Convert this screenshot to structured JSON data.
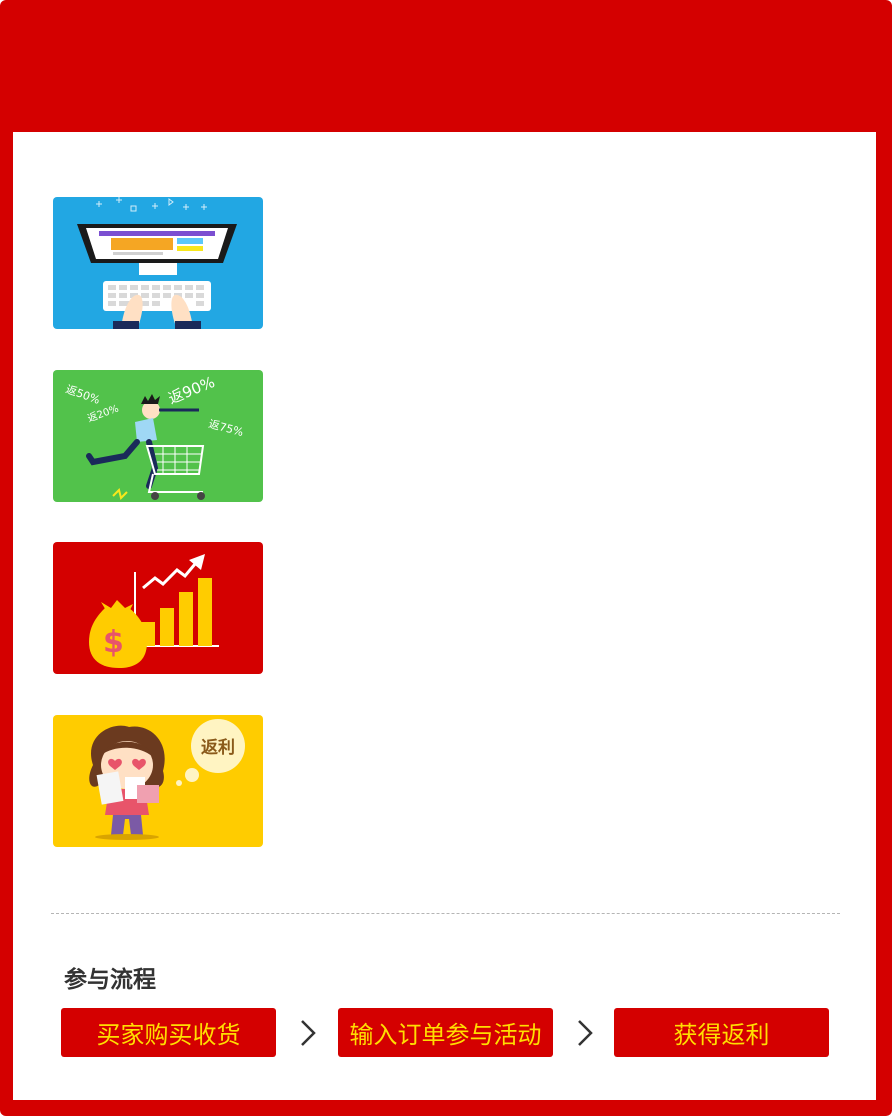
{
  "header": {
    "title": ""
  },
  "cards": [
    {
      "name": "online-shopping",
      "labels": []
    },
    {
      "name": "cashback-shopper",
      "labels": [
        "返50%",
        "返20%",
        "返90%",
        "返75%"
      ]
    },
    {
      "name": "money-growth",
      "labels": []
    },
    {
      "name": "happy-girl-rebate",
      "labels": [
        "返利"
      ]
    }
  ],
  "process": {
    "title": "参与流程",
    "steps": [
      "买家购买收货",
      "输入订单参与活动",
      "获得返利"
    ]
  },
  "colors": {
    "brand_red": "#d40000",
    "step_text": "#ffde00",
    "card_blue": "#22a7e3",
    "card_green": "#52c24b",
    "card_yellow": "#ffcc00"
  }
}
